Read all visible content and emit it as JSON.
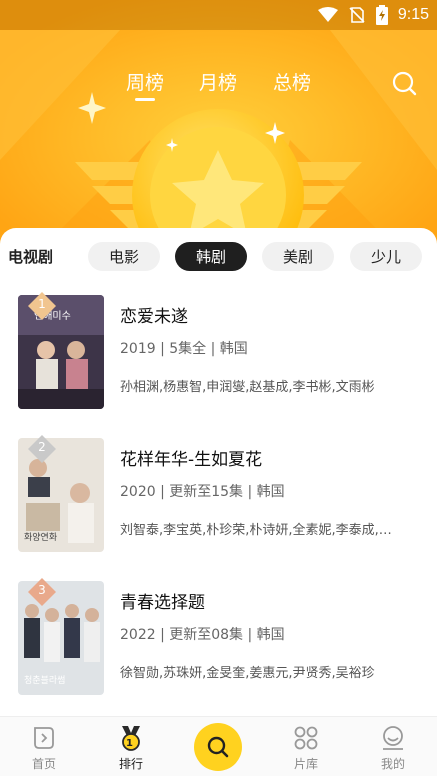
{
  "status_bar": {
    "time": "9:15",
    "icons": [
      "wifi-icon",
      "no-sim-icon",
      "battery-charging-icon"
    ]
  },
  "header": {
    "tabs": [
      {
        "label": "周榜",
        "active": true
      },
      {
        "label": "月榜",
        "active": false
      },
      {
        "label": "总榜",
        "active": false
      }
    ],
    "search_icon": "search-icon",
    "banner_icon": "gold-star-medal"
  },
  "categories": [
    {
      "label": "电视剧",
      "active": false
    },
    {
      "label": "电影",
      "active": false
    },
    {
      "label": "韩剧",
      "active": true
    },
    {
      "label": "美剧",
      "active": false
    },
    {
      "label": "少儿",
      "active": false
    }
  ],
  "shows": [
    {
      "rank": "1",
      "title": "恋爱未遂",
      "meta": "2019 | 5集全 | 韩国",
      "cast": "孙相渊,杨惠智,申润燮,赵基成,李书彬,文雨彬",
      "poster_text": "연애미수"
    },
    {
      "rank": "2",
      "title": "花样年华-生如夏花",
      "meta": "2020 | 更新至15集 | 韩国",
      "cast": "刘智泰,李宝英,朴珍荣,朴诗妍,全素妮,李泰成,…",
      "poster_text": "화양연화"
    },
    {
      "rank": "3",
      "title": "青春选择题",
      "meta": "2022 | 更新至08集 | 韩国",
      "cast": "徐智勋,苏珠妍,金旻奎,姜惠元,尹贤秀,吴裕珍",
      "poster_text": "청춘블라썸"
    }
  ],
  "bottom_nav": {
    "items": [
      {
        "label": "首页",
        "icon": "home-icon",
        "active": false
      },
      {
        "label": "排行",
        "icon": "ranking-medal-icon",
        "active": true
      },
      {
        "label": "片库",
        "icon": "library-grid-icon",
        "active": false
      },
      {
        "label": "我的",
        "icon": "profile-icon",
        "active": false
      }
    ],
    "center_icon": "search-icon",
    "ranking_badge": "1"
  },
  "colors": {
    "banner": "#ffb21f",
    "accent": "#ffd21f",
    "active_chip": "#1f1f1f"
  }
}
